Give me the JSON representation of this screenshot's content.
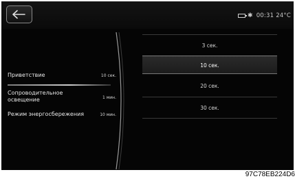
{
  "status_bar": {
    "time": "00:31",
    "temperature": "24°C"
  },
  "settings": [
    {
      "label": "Приветствие",
      "value": "10 сек."
    },
    {
      "label": "Сопроводительное освещение",
      "value": "1 мин."
    },
    {
      "label": "Режим энергосбережения",
      "value": "10 мин."
    }
  ],
  "options": [
    {
      "label": "3 сек."
    },
    {
      "label": "10 сек.",
      "selected": true
    },
    {
      "label": "20 сек."
    },
    {
      "label": "30 сек."
    }
  ],
  "caption": "97C78EB224D6"
}
